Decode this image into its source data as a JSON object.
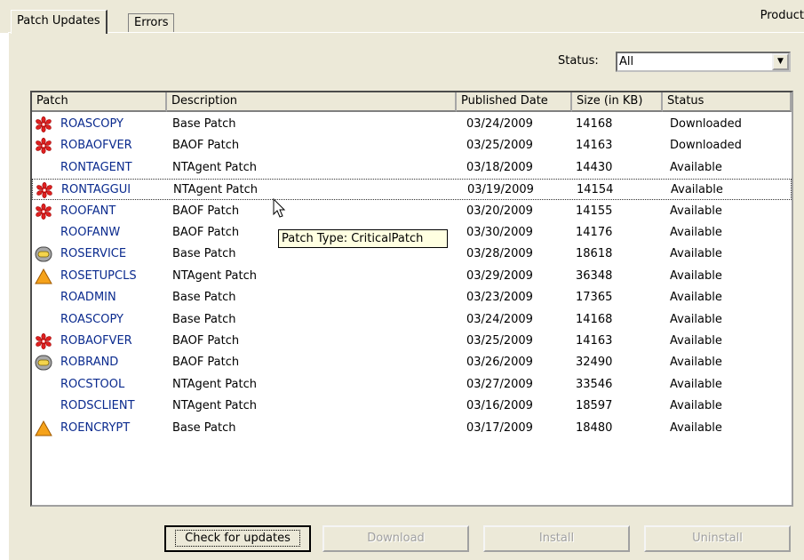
{
  "tabs": [
    {
      "label": "Patch Updates"
    },
    {
      "label": "Errors"
    }
  ],
  "product_label": "Product",
  "filter": {
    "label": "Status:",
    "value": "All"
  },
  "columns": [
    "Patch",
    "Description",
    "Published Date",
    "Size (in KB)",
    "Status"
  ],
  "rows": [
    {
      "icon": "critical-icon",
      "patch": "ROASCOPY",
      "description": "Base Patch",
      "date": "03/24/2009",
      "size": "14168",
      "status": "Downloaded"
    },
    {
      "icon": "critical-icon",
      "patch": "ROBAOFVER",
      "description": "BAOF Patch",
      "date": "03/25/2009",
      "size": "14163",
      "status": "Downloaded"
    },
    {
      "icon": "none",
      "patch": "RONTAGENT",
      "description": "NTAgent Patch",
      "date": "03/18/2009",
      "size": "14430",
      "status": "Available"
    },
    {
      "icon": "critical-icon",
      "patch": "RONTAGGUI",
      "description": "NTAgent Patch",
      "date": "03/19/2009",
      "size": "14154",
      "status": "Available"
    },
    {
      "icon": "critical-icon",
      "patch": "ROOFANT",
      "description": "BAOF Patch",
      "date": "03/20/2009",
      "size": "14155",
      "status": "Available"
    },
    {
      "icon": "none",
      "patch": "ROOFANW",
      "description": "BAOF Patch",
      "date": "03/30/2009",
      "size": "14176",
      "status": "Available"
    },
    {
      "icon": "optional-icon",
      "patch": "ROSERVICE",
      "description": "Base Patch",
      "date": "03/28/2009",
      "size": "18618",
      "status": "Available"
    },
    {
      "icon": "warning-icon",
      "patch": "ROSETUPCLS",
      "description": "NTAgent Patch",
      "date": "03/29/2009",
      "size": "36348",
      "status": "Available"
    },
    {
      "icon": "none",
      "patch": "ROADMIN",
      "description": "Base Patch",
      "date": "03/23/2009",
      "size": "17365",
      "status": "Available"
    },
    {
      "icon": "none",
      "patch": "ROASCOPY",
      "description": "Base Patch",
      "date": "03/24/2009",
      "size": "14168",
      "status": "Available"
    },
    {
      "icon": "critical-icon",
      "patch": "ROBAOFVER",
      "description": "BAOF Patch",
      "date": "03/25/2009",
      "size": "14163",
      "status": "Available"
    },
    {
      "icon": "optional-icon",
      "patch": "ROBRAND",
      "description": "BAOF Patch",
      "date": "03/26/2009",
      "size": "32490",
      "status": "Available"
    },
    {
      "icon": "none",
      "patch": "ROCSTOOL",
      "description": "NTAgent Patch",
      "date": "03/27/2009",
      "size": "33546",
      "status": "Available"
    },
    {
      "icon": "none",
      "patch": "RODSCLIENT",
      "description": "NTAgent Patch",
      "date": "03/16/2009",
      "size": "18597",
      "status": "Available"
    },
    {
      "icon": "warning-icon",
      "patch": "ROENCRYPT",
      "description": "Base Patch",
      "date": "03/17/2009",
      "size": "18480",
      "status": "Available"
    }
  ],
  "tooltip": "Patch Type: CriticalPatch",
  "buttons": [
    {
      "label": "Check for updates",
      "enabled": true
    },
    {
      "label": "Download",
      "enabled": false
    },
    {
      "label": "Install",
      "enabled": false
    },
    {
      "label": "Uninstall",
      "enabled": false
    }
  ]
}
